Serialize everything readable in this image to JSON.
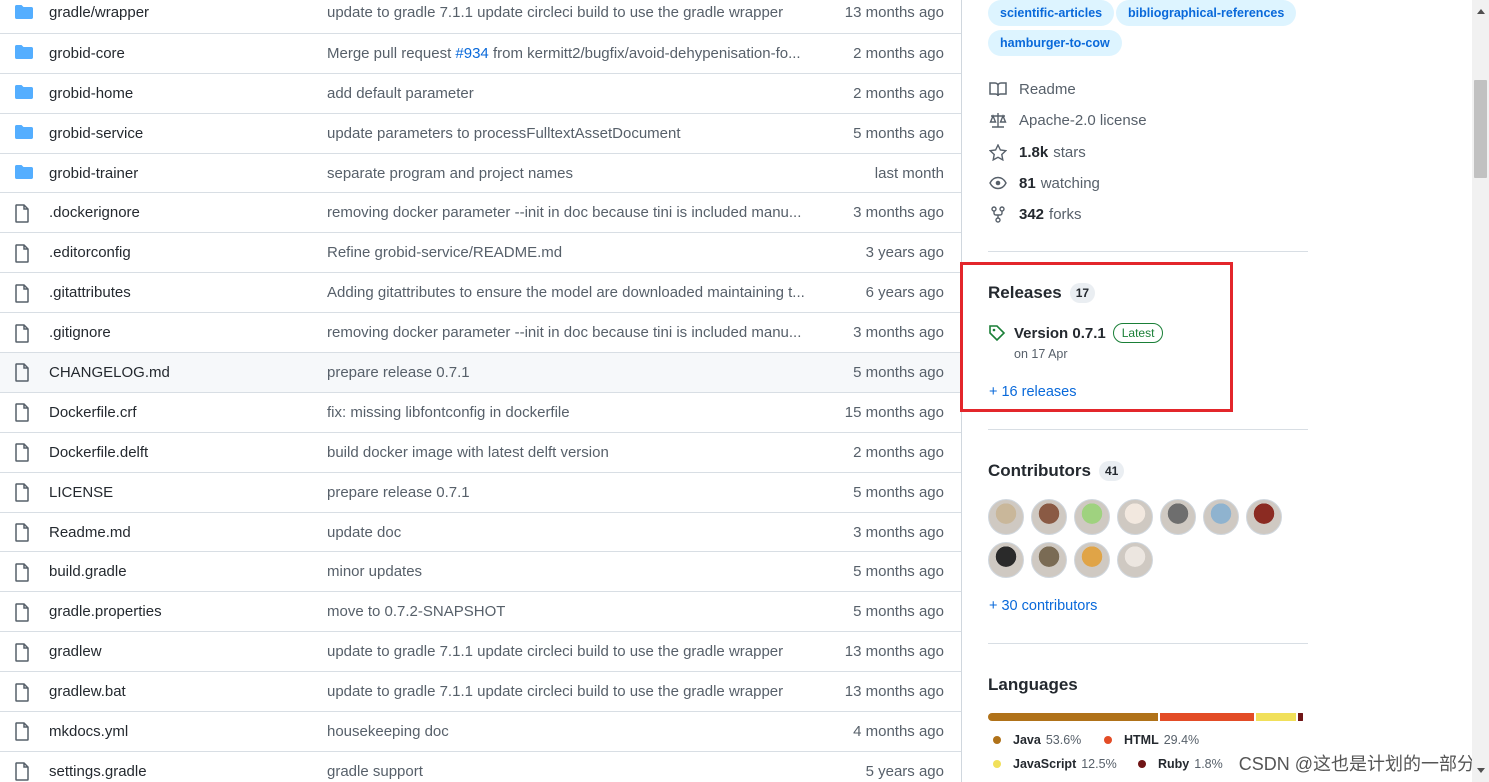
{
  "files": [
    {
      "type": "dir",
      "name": "gradle/wrapper",
      "message": "update to gradle 7.1.1 update circleci build to use the gradle wrapper",
      "age": "13 months ago"
    },
    {
      "type": "dir",
      "name": "grobid-core",
      "message_pre": "Merge pull request ",
      "message_link": "#934",
      "message_post": " from kermitt2/bugfix/avoid-dehypenisation-fo...",
      "age": "2 months ago"
    },
    {
      "type": "dir",
      "name": "grobid-home",
      "message": "add default parameter",
      "age": "2 months ago"
    },
    {
      "type": "dir",
      "name": "grobid-service",
      "message": "update parameters to processFulltextAssetDocument",
      "age": "5 months ago"
    },
    {
      "type": "dir",
      "name": "grobid-trainer",
      "message": "separate program and project names",
      "age": "last month"
    },
    {
      "type": "file",
      "name": ".dockerignore",
      "message": "removing docker parameter --init in doc because tini is included manu...",
      "age": "3 months ago"
    },
    {
      "type": "file",
      "name": ".editorconfig",
      "message": "Refine grobid-service/README.md",
      "age": "3 years ago"
    },
    {
      "type": "file",
      "name": ".gitattributes",
      "message": "Adding gitattributes to ensure the model are downloaded maintaining t...",
      "age": "6 years ago"
    },
    {
      "type": "file",
      "name": ".gitignore",
      "message": "removing docker parameter --init in doc because tini is included manu...",
      "age": "3 months ago"
    },
    {
      "type": "file",
      "name": "CHANGELOG.md",
      "message": "prepare release 0.7.1",
      "age": "5 months ago"
    },
    {
      "type": "file",
      "name": "Dockerfile.crf",
      "message": "fix: missing libfontconfig in dockerfile",
      "age": "15 months ago"
    },
    {
      "type": "file",
      "name": "Dockerfile.delft",
      "message": "build docker image with latest delft version",
      "age": "2 months ago"
    },
    {
      "type": "file",
      "name": "LICENSE",
      "message": "prepare release 0.7.1",
      "age": "5 months ago"
    },
    {
      "type": "file",
      "name": "Readme.md",
      "message": "update doc",
      "age": "3 months ago"
    },
    {
      "type": "file",
      "name": "build.gradle",
      "message": "minor updates",
      "age": "5 months ago"
    },
    {
      "type": "file",
      "name": "gradle.properties",
      "message": "move to 0.7.2-SNAPSHOT",
      "age": "5 months ago"
    },
    {
      "type": "file",
      "name": "gradlew",
      "message": "update to gradle 7.1.1 update circleci build to use the gradle wrapper",
      "age": "13 months ago"
    },
    {
      "type": "file",
      "name": "gradlew.bat",
      "message": "update to gradle 7.1.1 update circleci build to use the gradle wrapper",
      "age": "13 months ago"
    },
    {
      "type": "file",
      "name": "mkdocs.yml",
      "message": "housekeeping doc",
      "age": "4 months ago"
    },
    {
      "type": "file",
      "name": "settings.gradle",
      "message": "gradle support",
      "age": "5 years ago"
    }
  ],
  "topics": [
    "scientific-articles",
    "bibliographical-references",
    "hamburger-to-cow"
  ],
  "about": {
    "readme": "Readme",
    "license": "Apache-2.0 license",
    "stars_count": "1.8k",
    "stars_label": "stars",
    "watching_count": "81",
    "watching_label": "watching",
    "forks_count": "342",
    "forks_label": "forks"
  },
  "releases": {
    "title": "Releases",
    "count": "17",
    "latest_name": "Version 0.7.1",
    "latest_badge": "Latest",
    "latest_date": "on 17 Apr",
    "more": "+ 16 releases"
  },
  "contributors": {
    "title": "Contributors",
    "count": "41",
    "more": "+ 30 contributors",
    "avatar_colors": [
      "#c9b79a",
      "#8a5a44",
      "#9fd27f",
      "#f2e8df",
      "#6e6e6e",
      "#8fb3cf",
      "#8b2b22",
      "#2a2a2a",
      "#7a6b54",
      "#e0a447",
      "#ece6e0"
    ]
  },
  "languages": {
    "title": "Languages",
    "items": [
      {
        "name": "Java",
        "pct": "53.6%",
        "value": 53.6,
        "color": "#b07219"
      },
      {
        "name": "HTML",
        "pct": "29.4%",
        "value": 29.4,
        "color": "#e34c26"
      },
      {
        "name": "JavaScript",
        "pct": "12.5%",
        "value": 12.5,
        "color": "#f1e05a"
      },
      {
        "name": "Ruby",
        "pct": "1.8%",
        "value": 1.8,
        "color": "#701516"
      }
    ],
    "other_colors": [
      "#3572A5",
      "#89e051"
    ]
  },
  "watermark": "CSDN @这也是计划的一部分"
}
